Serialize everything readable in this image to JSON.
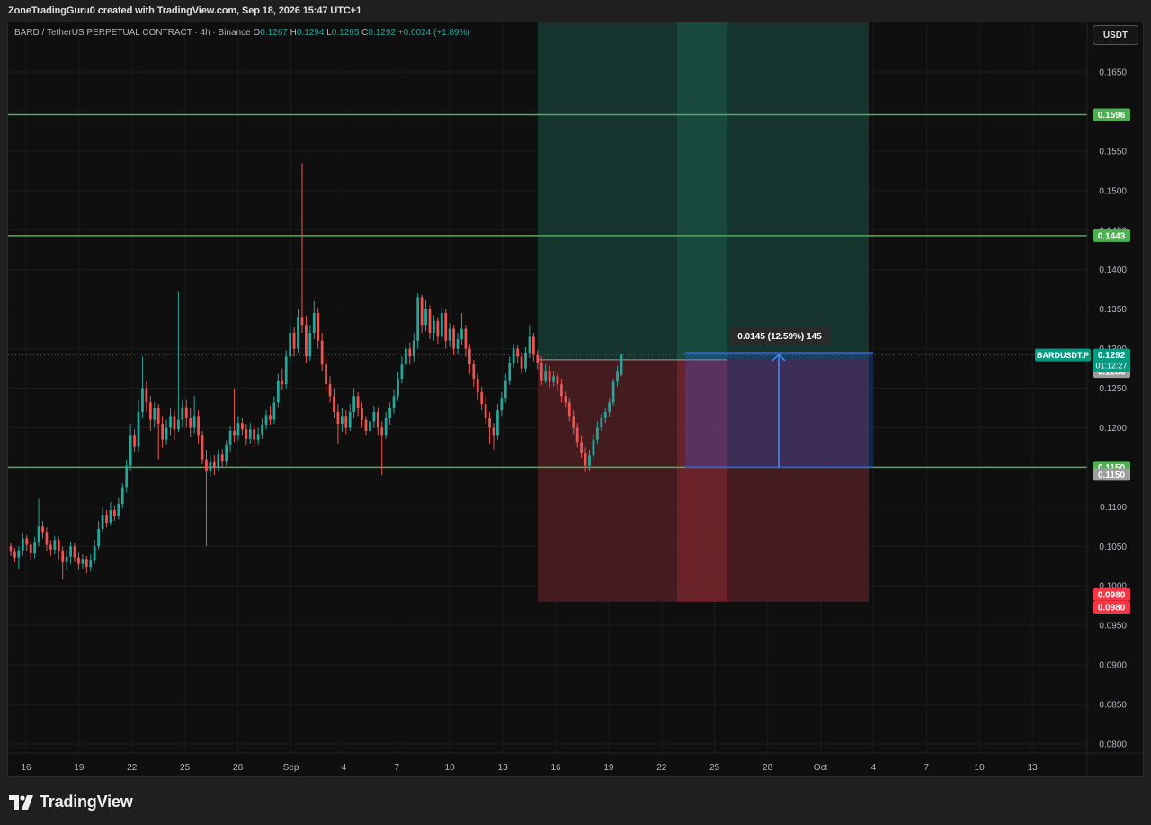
{
  "header": {
    "credit": "ZoneTradingGuru0 created with TradingView.com, Sep 18, 2026 15:47 UTC+1"
  },
  "legend": {
    "symbol": "BARD / TetherUS PERPETUAL CONTRACT · 4h · Binance",
    "o_label": "O",
    "o_value": "0.1267",
    "h_label": "H",
    "h_value": "0.1294",
    "l_label": "L",
    "l_value": "0.1265",
    "c_label": "C",
    "c_value": "0.1292",
    "change": "+0.0024 (+1.89%)"
  },
  "currency_button": "USDT",
  "brand": {
    "name": "TradingView",
    "logo_icon": "tradingview-logo-icon"
  },
  "colors": {
    "up": "#26a69a",
    "down": "#ef5350",
    "level_line": "#4caf50",
    "target_zone": "#163b33",
    "stop_zone": "#4a1e22",
    "measure_blue": "#2962ff"
  },
  "chart_data": {
    "type": "candlestick",
    "timeframe": "4h",
    "y_ticks": [
      "0.1650",
      "0.1600",
      "0.1550",
      "0.1500",
      "0.1450",
      "0.1400",
      "0.1350",
      "0.1300",
      "0.1250",
      "0.1200",
      "0.1150",
      "0.1100",
      "0.1050",
      "0.1000",
      "0.0950",
      "0.0900",
      "0.0850",
      "0.0800"
    ],
    "ylim": [
      0.0765,
      0.172
    ],
    "x_ticks": [
      "16",
      "19",
      "22",
      "25",
      "28",
      "Sep",
      "4",
      "7",
      "10",
      "13",
      "16",
      "19",
      "22",
      "25",
      "28",
      "Oct",
      "4",
      "7",
      "10",
      "13"
    ],
    "horizontal_levels": [
      0.1596,
      0.1443,
      0.115
    ],
    "level_labels": [
      "0.1596",
      "0.1443",
      "0.1150"
    ],
    "position": {
      "side": "long",
      "entry": 0.1286,
      "target": 0.1725,
      "stop": 0.098,
      "entry_label": "0.1286",
      "stop_labels": [
        "0.0980",
        "0.0980"
      ],
      "stop_line_label": "0.1150"
    },
    "measure": {
      "from": 0.115,
      "to": 0.1295,
      "label": "0.0145 (12.59%) 145"
    },
    "last_price": {
      "symbol": "BARDUSDT.P",
      "value": "0.1292",
      "countdown": "01:12:27"
    },
    "candles": [
      [
        0.105,
        0.1043,
        0.1054,
        0.1038
      ],
      [
        0.1043,
        0.1036,
        0.1048,
        0.103
      ],
      [
        0.1036,
        0.1045,
        0.105,
        0.1022
      ],
      [
        0.1045,
        0.106,
        0.1068,
        0.1038
      ],
      [
        0.106,
        0.1052,
        0.1064,
        0.1044
      ],
      [
        0.1052,
        0.1041,
        0.1057,
        0.1033
      ],
      [
        0.1041,
        0.1056,
        0.1062,
        0.1035
      ],
      [
        0.1056,
        0.1075,
        0.111,
        0.105
      ],
      [
        0.1075,
        0.1068,
        0.1082,
        0.106
      ],
      [
        0.1068,
        0.1052,
        0.1074,
        0.1044
      ],
      [
        0.1052,
        0.1046,
        0.1058,
        0.1038
      ],
      [
        0.1046,
        0.1058,
        0.1063,
        0.104
      ],
      [
        0.1058,
        0.1044,
        0.1062,
        0.1034
      ],
      [
        0.1044,
        0.103,
        0.105,
        0.1008
      ],
      [
        0.103,
        0.1037,
        0.1046,
        0.102
      ],
      [
        0.1037,
        0.105,
        0.1056,
        0.1028
      ],
      [
        0.105,
        0.1036,
        0.1054,
        0.103
      ],
      [
        0.1036,
        0.1028,
        0.1042,
        0.102
      ],
      [
        0.1028,
        0.1034,
        0.104,
        0.1022
      ],
      [
        0.1034,
        0.1024,
        0.1038,
        0.1016
      ],
      [
        0.1024,
        0.1032,
        0.104,
        0.1018
      ],
      [
        0.1032,
        0.105,
        0.1058,
        0.1028
      ],
      [
        0.105,
        0.1072,
        0.1082,
        0.1046
      ],
      [
        0.1072,
        0.109,
        0.11,
        0.1068
      ],
      [
        0.109,
        0.108,
        0.1096,
        0.1074
      ],
      [
        0.108,
        0.1096,
        0.1106,
        0.1076
      ],
      [
        0.1096,
        0.1088,
        0.1102,
        0.1082
      ],
      [
        0.1088,
        0.1104,
        0.1112,
        0.1084
      ],
      [
        0.1104,
        0.1125,
        0.113,
        0.1098
      ],
      [
        0.1125,
        0.1152,
        0.116,
        0.1118
      ],
      [
        0.1152,
        0.119,
        0.1205,
        0.1146
      ],
      [
        0.119,
        0.1176,
        0.1198,
        0.117
      ],
      [
        0.1176,
        0.122,
        0.1235,
        0.117
      ],
      [
        0.122,
        0.125,
        0.129,
        0.1212
      ],
      [
        0.125,
        0.1232,
        0.126,
        0.122
      ],
      [
        0.1232,
        0.121,
        0.124,
        0.1196
      ],
      [
        0.121,
        0.1225,
        0.1232,
        0.12
      ],
      [
        0.1225,
        0.1205,
        0.123,
        0.116
      ],
      [
        0.1205,
        0.1185,
        0.1215,
        0.1175
      ],
      [
        0.1185,
        0.12,
        0.121,
        0.1178
      ],
      [
        0.12,
        0.1215,
        0.1225,
        0.119
      ],
      [
        0.1215,
        0.1198,
        0.1222,
        0.1185
      ],
      [
        0.1198,
        0.121,
        0.1372,
        0.1195
      ],
      [
        0.121,
        0.1226,
        0.1235,
        0.12
      ],
      [
        0.1226,
        0.1212,
        0.1235,
        0.12
      ],
      [
        0.1212,
        0.12,
        0.1225,
        0.1188
      ],
      [
        0.12,
        0.1215,
        0.124,
        0.1193
      ],
      [
        0.1215,
        0.119,
        0.1222,
        0.118
      ],
      [
        0.119,
        0.116,
        0.1196,
        0.1154
      ],
      [
        0.116,
        0.1145,
        0.1172,
        0.105
      ],
      [
        0.1145,
        0.1156,
        0.1165,
        0.1138
      ],
      [
        0.1156,
        0.115,
        0.1165,
        0.114
      ],
      [
        0.115,
        0.1166,
        0.1172,
        0.1145
      ],
      [
        0.1166,
        0.1158,
        0.1173,
        0.115
      ],
      [
        0.1158,
        0.1178,
        0.1184,
        0.1152
      ],
      [
        0.1178,
        0.1196,
        0.1202,
        0.117
      ],
      [
        0.1196,
        0.119,
        0.125,
        0.1182
      ],
      [
        0.119,
        0.1206,
        0.1215,
        0.1184
      ],
      [
        0.1206,
        0.1198,
        0.1212,
        0.119
      ],
      [
        0.1198,
        0.1186,
        0.1205,
        0.1178
      ],
      [
        0.1186,
        0.1198,
        0.1206,
        0.118
      ],
      [
        0.1198,
        0.1185,
        0.1204,
        0.1176
      ],
      [
        0.1185,
        0.1192,
        0.12,
        0.1178
      ],
      [
        0.1192,
        0.1204,
        0.1212,
        0.1186
      ],
      [
        0.1204,
        0.1216,
        0.1222,
        0.1198
      ],
      [
        0.1216,
        0.121,
        0.1228,
        0.1204
      ],
      [
        0.121,
        0.1232,
        0.124,
        0.1205
      ],
      [
        0.1232,
        0.126,
        0.1268,
        0.1226
      ],
      [
        0.126,
        0.1255,
        0.1275,
        0.1248
      ],
      [
        0.1255,
        0.129,
        0.1298,
        0.125
      ],
      [
        0.129,
        0.132,
        0.133,
        0.1282
      ],
      [
        0.132,
        0.13,
        0.1328,
        0.129
      ],
      [
        0.13,
        0.134,
        0.135,
        0.1295
      ],
      [
        0.134,
        0.133,
        0.1535,
        0.132
      ],
      [
        0.133,
        0.129,
        0.1342,
        0.1282
      ],
      [
        0.129,
        0.132,
        0.133,
        0.1285
      ],
      [
        0.132,
        0.1345,
        0.136,
        0.1312
      ],
      [
        0.1345,
        0.131,
        0.1352,
        0.13
      ],
      [
        0.131,
        0.128,
        0.132,
        0.1272
      ],
      [
        0.128,
        0.1255,
        0.129,
        0.1245
      ],
      [
        0.1255,
        0.124,
        0.1265,
        0.1232
      ],
      [
        0.124,
        0.122,
        0.125,
        0.1212
      ],
      [
        0.122,
        0.1205,
        0.123,
        0.118
      ],
      [
        0.1205,
        0.1215,
        0.1225,
        0.1195
      ],
      [
        0.1215,
        0.12,
        0.1222,
        0.1192
      ],
      [
        0.12,
        0.122,
        0.123,
        0.1196
      ],
      [
        0.122,
        0.124,
        0.125,
        0.1212
      ],
      [
        0.124,
        0.1225,
        0.1245,
        0.1215
      ],
      [
        0.1225,
        0.121,
        0.1232,
        0.12
      ],
      [
        0.121,
        0.1196,
        0.1215,
        0.119
      ],
      [
        0.1196,
        0.1208,
        0.1215,
        0.1192
      ],
      [
        0.1208,
        0.122,
        0.1228,
        0.12
      ],
      [
        0.122,
        0.12,
        0.1226,
        0.119
      ],
      [
        0.12,
        0.119,
        0.1208,
        0.114
      ],
      [
        0.119,
        0.1212,
        0.122,
        0.1186
      ],
      [
        0.1212,
        0.1225,
        0.1232,
        0.1204
      ],
      [
        0.1225,
        0.124,
        0.1248,
        0.1218
      ],
      [
        0.124,
        0.1262,
        0.127,
        0.1234
      ],
      [
        0.1262,
        0.128,
        0.129,
        0.1256
      ],
      [
        0.128,
        0.13,
        0.131,
        0.1274
      ],
      [
        0.13,
        0.129,
        0.1308,
        0.128
      ],
      [
        0.129,
        0.131,
        0.132,
        0.1284
      ],
      [
        0.131,
        0.1365,
        0.137,
        0.13
      ],
      [
        0.1365,
        0.133,
        0.1368,
        0.132
      ],
      [
        0.133,
        0.135,
        0.1362,
        0.1322
      ],
      [
        0.135,
        0.132,
        0.1355,
        0.1312
      ],
      [
        0.132,
        0.1335,
        0.1342,
        0.131
      ],
      [
        0.1335,
        0.1315,
        0.134,
        0.1306
      ],
      [
        0.1315,
        0.1345,
        0.1352,
        0.1308
      ],
      [
        0.1345,
        0.131,
        0.135,
        0.13
      ],
      [
        0.131,
        0.1325,
        0.1332,
        0.1302
      ],
      [
        0.1325,
        0.13,
        0.133,
        0.1292
      ],
      [
        0.13,
        0.1312,
        0.132,
        0.1294
      ],
      [
        0.1312,
        0.1325,
        0.1345,
        0.1305
      ],
      [
        0.1325,
        0.13,
        0.133,
        0.129
      ],
      [
        0.13,
        0.128,
        0.1306,
        0.1268
      ],
      [
        0.128,
        0.1262,
        0.1286,
        0.1252
      ],
      [
        0.1262,
        0.1245,
        0.1268,
        0.1235
      ],
      [
        0.1245,
        0.123,
        0.1252,
        0.1222
      ],
      [
        0.123,
        0.1212,
        0.124,
        0.1205
      ],
      [
        0.1212,
        0.12,
        0.122,
        0.118
      ],
      [
        0.12,
        0.119,
        0.1206,
        0.1172
      ],
      [
        0.119,
        0.1222,
        0.123,
        0.1185
      ],
      [
        0.1222,
        0.1238,
        0.1245,
        0.1215
      ],
      [
        0.1238,
        0.126,
        0.1268,
        0.1232
      ],
      [
        0.126,
        0.1282,
        0.129,
        0.1254
      ],
      [
        0.1282,
        0.13,
        0.1306,
        0.1276
      ],
      [
        0.13,
        0.129,
        0.1305,
        0.1282
      ],
      [
        0.129,
        0.1275,
        0.1296,
        0.1268
      ],
      [
        0.1275,
        0.1295,
        0.1302,
        0.127
      ],
      [
        0.1295,
        0.1315,
        0.133,
        0.1288
      ],
      [
        0.1315,
        0.1292,
        0.132,
        0.1284
      ],
      [
        0.1292,
        0.1282,
        0.1298,
        0.1274
      ],
      [
        0.1282,
        0.126,
        0.129,
        0.1254
      ],
      [
        0.126,
        0.1272,
        0.128,
        0.1256
      ],
      [
        0.1272,
        0.1258,
        0.1278,
        0.125
      ],
      [
        0.1258,
        0.1265,
        0.1272,
        0.1252
      ],
      [
        0.1265,
        0.1255,
        0.127,
        0.1246
      ],
      [
        0.1255,
        0.124,
        0.1262,
        0.1232
      ],
      [
        0.124,
        0.1232,
        0.1246,
        0.1226
      ],
      [
        0.1232,
        0.1215,
        0.1238,
        0.1208
      ],
      [
        0.1215,
        0.12,
        0.1222,
        0.1192
      ],
      [
        0.12,
        0.1182,
        0.1206,
        0.1175
      ],
      [
        0.1182,
        0.1168,
        0.119,
        0.1162
      ],
      [
        0.1168,
        0.1152,
        0.1175,
        0.1144
      ],
      [
        0.1152,
        0.1165,
        0.1172,
        0.1145
      ],
      [
        0.1165,
        0.1185,
        0.1192,
        0.116
      ],
      [
        0.1185,
        0.12,
        0.1208,
        0.118
      ],
      [
        0.12,
        0.1212,
        0.1218,
        0.1196
      ],
      [
        0.1212,
        0.122,
        0.1226,
        0.1206
      ],
      [
        0.122,
        0.1232,
        0.1238,
        0.1214
      ],
      [
        0.1232,
        0.1258,
        0.1262,
        0.1228
      ],
      [
        0.1258,
        0.1272,
        0.1278,
        0.1252
      ],
      [
        0.1267,
        0.1292,
        0.1294,
        0.1265
      ]
    ]
  }
}
